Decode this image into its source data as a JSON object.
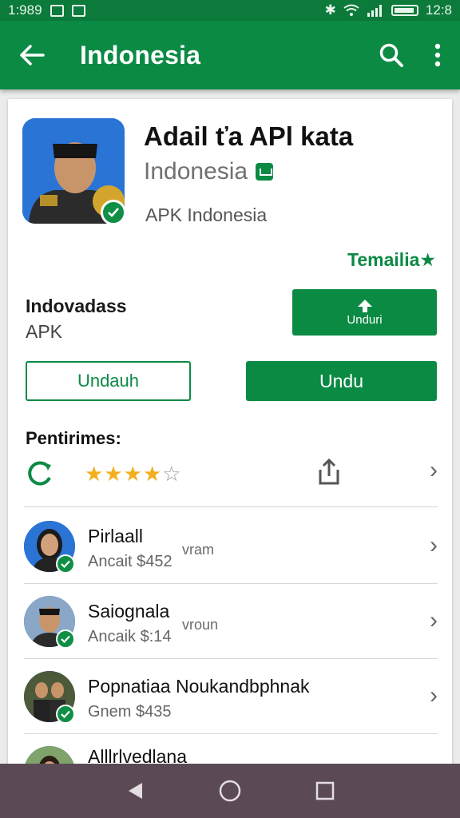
{
  "status_bar": {
    "time": "1:989",
    "battery_text": "12:8"
  },
  "app_bar": {
    "title": "Indonesia",
    "back_icon": "arrow-left-icon",
    "search_icon": "search-icon",
    "more_icon": "more-vert-icon"
  },
  "app": {
    "name": "Adail ťa APl kata",
    "developer": "Indonesia",
    "subtitle": "APK Indonesia",
    "featured_label": "Temailia★"
  },
  "info": {
    "title": "Indovadass",
    "subtitle": "APK"
  },
  "buttons": {
    "install_label": "Unduri",
    "outline_label": "Undauh",
    "solid_label": "Undu"
  },
  "reviews": {
    "title": "Pentirimes:",
    "stars_filled": 4,
    "stars_total": 5
  },
  "list": [
    {
      "name": "Pirlaall",
      "meta": "Ancait $452",
      "tag": "vram"
    },
    {
      "name": "Saiognala",
      "meta": "Ancaik $:14",
      "tag": "vroun"
    },
    {
      "name": "Popnatiaa Noukandbphnak",
      "meta": "Gnem $435",
      "tag": ""
    },
    {
      "name": "Alllrlvedlana",
      "meta": "",
      "tag": ""
    }
  ],
  "colors": {
    "brand_green": "#0b8a44",
    "status_green": "#0b7a3a",
    "nav_bar": "#5b4a56",
    "star": "#f2b01e"
  }
}
